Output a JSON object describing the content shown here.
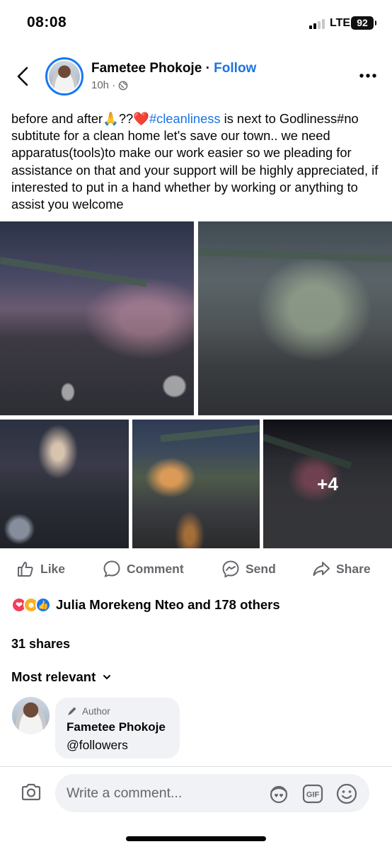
{
  "status_bar": {
    "time": "08:08",
    "network": "LTE",
    "battery": "92"
  },
  "post": {
    "author": "Fametee Phokoje",
    "separator": "·",
    "follow_label": "Follow",
    "time": "10h ·",
    "text_before_hashtag": "before and after🙏??❤️",
    "hashtag": "#cleanliness",
    "text_after_hashtag": " is next to Godliness#no subtitute for a clean home let's save our town.. we need apparatus(tools)to make  our work easier so we pleading for assistance on that and your support will be highly appreciated, if interested to put in a hand whether by working or anything to assist you welcome",
    "photo_more_count": "+4"
  },
  "actions": {
    "like": "Like",
    "comment": "Comment",
    "send": "Send",
    "share": "Share"
  },
  "reactions": {
    "reactors": "Julia Morekeng Nteo and 178 others",
    "types": [
      "love-icon",
      "care-icon",
      "like-icon"
    ]
  },
  "shares": "31 shares",
  "sort": {
    "label": "Most relevant"
  },
  "comment": {
    "badge": "Author",
    "name": "Fametee Phokoje",
    "text": "@followers"
  },
  "composer": {
    "placeholder": "Write a comment..."
  },
  "colors": {
    "accent": "#1b74e4",
    "secondary_text": "#65676b",
    "bubble": "#f0f2f5"
  }
}
